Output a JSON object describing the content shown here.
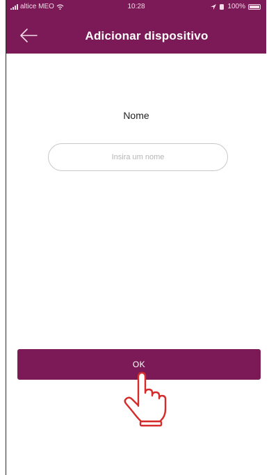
{
  "status_bar": {
    "carrier": "altice MEO",
    "time": "10:28",
    "battery": "100%",
    "icons": [
      "signal-icon",
      "wifi-icon",
      "location-icon",
      "alarm-icon",
      "battery-icon"
    ]
  },
  "header": {
    "title": "Adicionar dispositivo",
    "back_icon": "arrow-left-icon"
  },
  "form": {
    "name_label": "Nome",
    "name_placeholder": "Insira um nome",
    "name_value": ""
  },
  "actions": {
    "ok_label": "OK"
  },
  "overlay": {
    "pointer_icon": "tap-hand-icon"
  },
  "colors": {
    "brand": "#7b1a57",
    "hand_outline": "#d62b2b",
    "input_border": "#c8c8c8",
    "placeholder": "#b5b5b5"
  }
}
